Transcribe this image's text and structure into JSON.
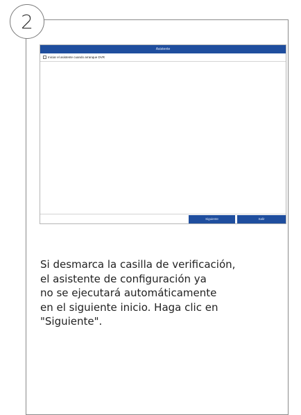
{
  "step": {
    "number": "2"
  },
  "wizard": {
    "title": "Asistente",
    "checkbox_label": "Iniciar el asistente cuando arranque DVR",
    "buttons": {
      "next": "Siguiente",
      "exit": "Salir"
    }
  },
  "description": {
    "lines": [
      "Si desmarca la casilla de verificación,",
      "el asistente de configuración ya",
      "no se ejecutará automáticamente",
      "en el siguiente inicio. Haga clic en",
      "\"Siguiente\"."
    ]
  }
}
